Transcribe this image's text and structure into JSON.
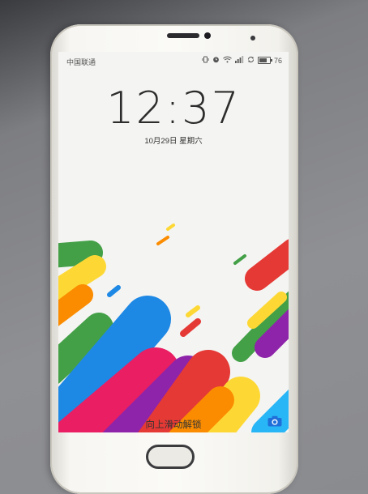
{
  "status_bar": {
    "carrier": "中国联通",
    "battery_level": "76",
    "battery_fraction": 0.76,
    "icons": [
      "vibrate-icon",
      "alarm-icon",
      "wifi-icon",
      "signal-icon",
      "sync-icon",
      "battery-icon"
    ]
  },
  "lockscreen": {
    "time": "12:37",
    "date": "10月29日  星期六",
    "unlock_hint": "向上滑动解锁",
    "camera_icon": "camera-icon"
  },
  "colors": {
    "clock_text": "#2c2c2c",
    "screen_background": "#f4f4f2",
    "wallpaper_palette": [
      "#e53935",
      "#43a047",
      "#1e88e5",
      "#fdd835",
      "#8e24aa",
      "#fb8c00",
      "#e91e63",
      "#29b6f6"
    ]
  }
}
